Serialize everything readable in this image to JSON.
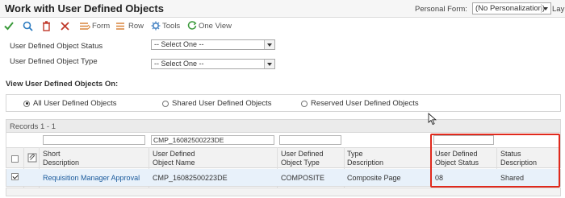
{
  "window": {
    "title": "Work with User Defined Objects",
    "personal_form_label": "Personal Form:",
    "personal_form_value": "(No Personalization)",
    "layout_label": "Lay"
  },
  "toolbar": {
    "select_icon": "checkmark-icon",
    "find_icon": "magnifier-icon",
    "delete_icon": "trash-icon",
    "close_icon": "x-icon",
    "form_label": "Form",
    "row_label": "Row",
    "tools_label": "Tools",
    "oneview_label": "One View"
  },
  "filters": {
    "status_label": "User Defined Object Status",
    "status_value": "-- Select One --",
    "type_label": "User Defined Object Type",
    "type_value": "-- Select One --"
  },
  "view": {
    "label": "View User Defined Objects On:",
    "options": [
      "All User Defined Objects",
      "Shared User Defined Objects",
      "Reserved User Defined Objects"
    ],
    "selected": "All User Defined Objects"
  },
  "grid": {
    "records": "Records 1 - 1",
    "qbe": {
      "object_name": "CMP_16082500223DE"
    },
    "columns": {
      "short_description": [
        "Short",
        "Description"
      ],
      "object_name": [
        "User Defined",
        "Object Name"
      ],
      "object_type": [
        "User Defined",
        "Object Type"
      ],
      "type_description": [
        "Type",
        "Description"
      ],
      "object_status": [
        "User Defined",
        "Object Status"
      ],
      "status_description": [
        "Status",
        "Description"
      ]
    },
    "rows": [
      {
        "selected": true,
        "short_description": "Requisition Manager Approval",
        "object_name": "CMP_16082500223DE",
        "object_type": "COMPOSITE",
        "type_description": "Composite Page",
        "object_status": "08",
        "status_description": "Shared"
      }
    ]
  },
  "colors": {
    "highlight_box": "#e02a1d",
    "link": "#1a5a9c",
    "selected_row": "#e8f1fa"
  }
}
